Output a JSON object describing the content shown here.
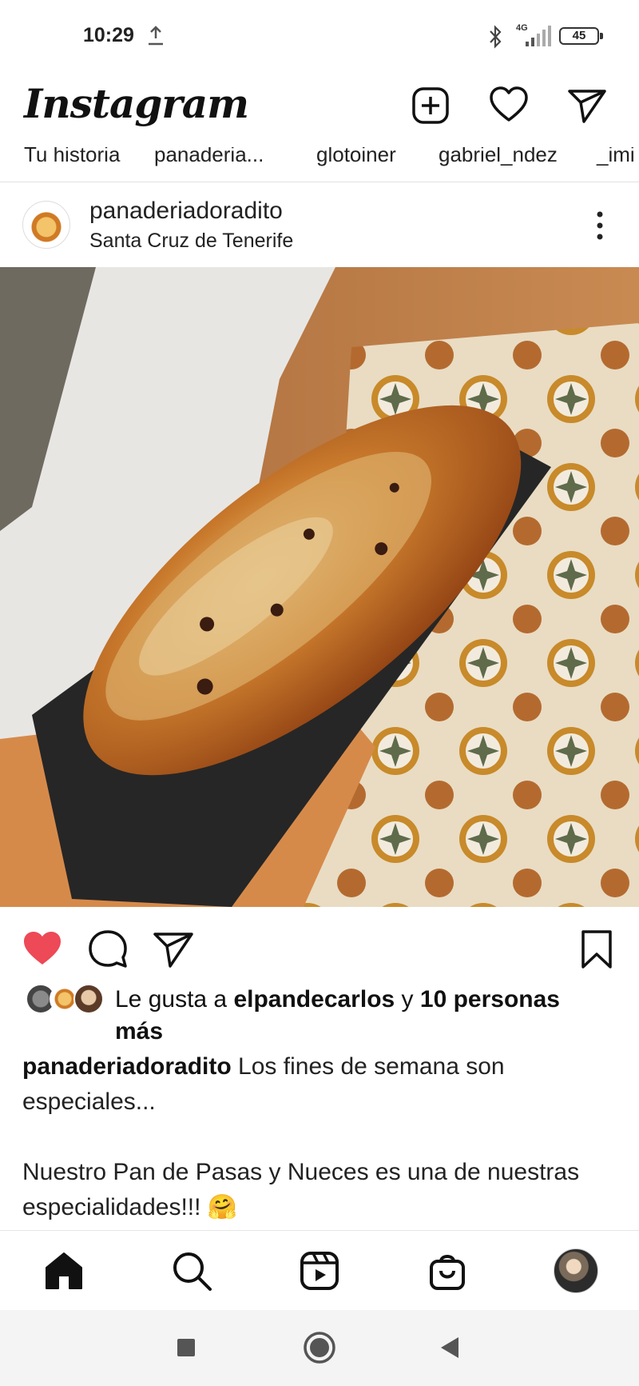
{
  "status_bar": {
    "time": "10:29",
    "network": "4G",
    "battery": "45"
  },
  "app": {
    "name": "Instagram"
  },
  "header": {
    "icons": [
      "plus-square-icon",
      "heart-icon",
      "send-icon"
    ]
  },
  "stories": [
    "Tu historia",
    "panaderia...",
    "glotoiner",
    "gabriel_ndez",
    "_imi"
  ],
  "post": {
    "username": "panaderiadoradito",
    "location": "Santa Cruz de Tenerife",
    "likes_prefix": "Le gusta a ",
    "likes_user": "elpandecarlos",
    "likes_middle": " y ",
    "likes_count": "10 personas más",
    "caption_user": "panaderiadoradito",
    "caption_text": " Los fines de semana son especiales...",
    "caption_line2": "Nuestro Pan de Pasas y Nueces es una de nuestras especialidades!!! 🤗",
    "liked": true,
    "colors": {
      "like": "#ed4956"
    }
  },
  "bottom_nav": {
    "items": [
      "home-icon",
      "search-icon",
      "reels-icon",
      "shop-icon",
      "profile-avatar"
    ]
  }
}
